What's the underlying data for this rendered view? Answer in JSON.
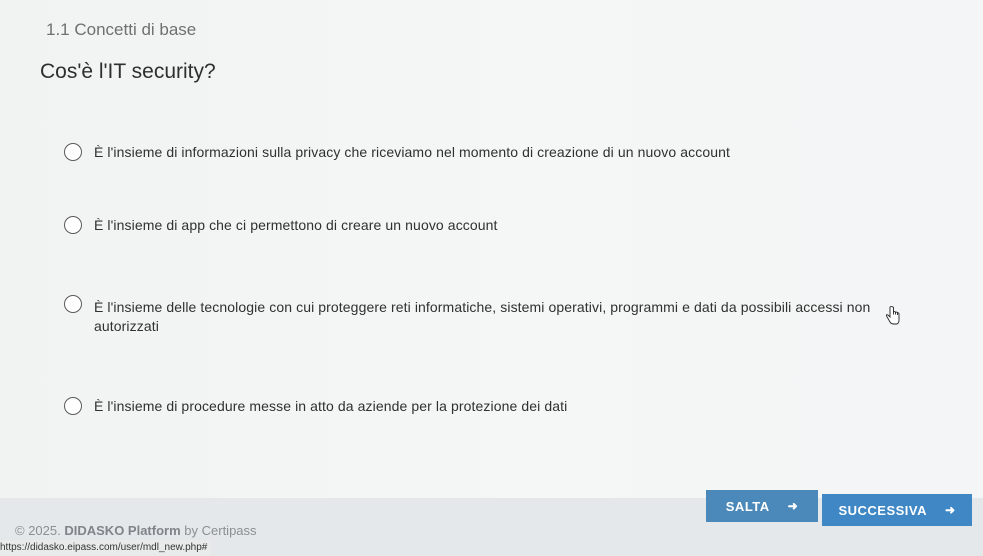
{
  "section": {
    "title": "1.1 Concetti di base"
  },
  "question": {
    "text": "Cos'è l'IT security?"
  },
  "options": [
    {
      "label": "È l'insieme di informazioni sulla privacy che riceviamo nel momento di creazione di un nuovo account"
    },
    {
      "label": "È l'insieme di app che ci permettono di creare un nuovo account"
    },
    {
      "label": "È l'insieme delle tecnologie con cui proteggere reti informatiche, sistemi operativi, programmi e dati da possibili accessi non autorizzati"
    },
    {
      "label": "È l'insieme di procedure messe in atto da aziende per la protezione dei dati"
    }
  ],
  "buttons": {
    "skip": "SALTA",
    "next": "SUCCESSIVA"
  },
  "footer": {
    "copyright": "© 2025.",
    "brand": "DIDASKO Platform",
    "by": "by Certipass"
  },
  "status_url": "https://didasko.eipass.com/user/mdl_new.php#",
  "colors": {
    "button_blue": "#4a89b9",
    "button_next": "#3f88c5"
  }
}
